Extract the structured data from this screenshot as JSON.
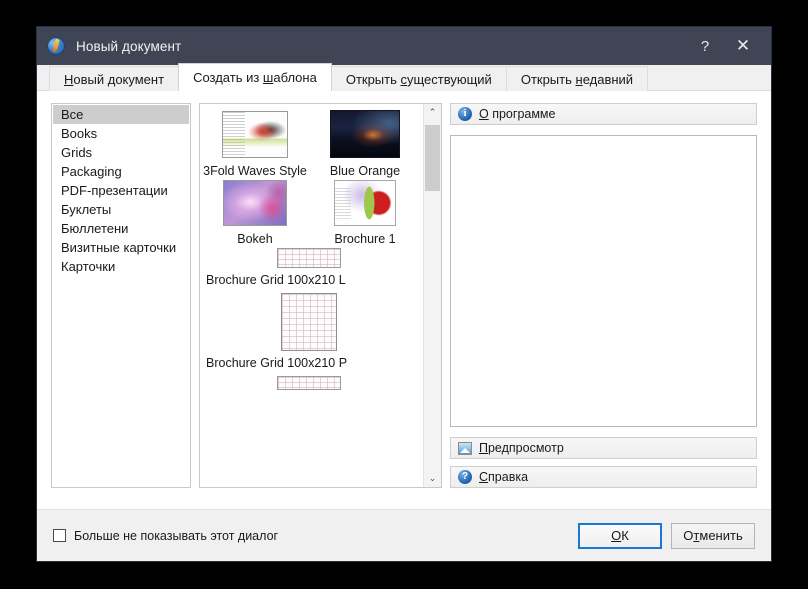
{
  "window": {
    "title": "Новый документ",
    "app_icon": "scribus-icon",
    "help_button": "?",
    "close_button": "✕",
    "titlebar_color": "#3f4554"
  },
  "tabs": [
    {
      "label_pre": "",
      "accel": "Н",
      "label_post": "овый документ",
      "active": false,
      "name": "tab-new-document"
    },
    {
      "label_pre": "Создать из ",
      "accel": "ш",
      "label_post": "аблона",
      "active": true,
      "name": "tab-create-from-template"
    },
    {
      "label_pre": "Открыть ",
      "accel": "с",
      "label_post": "уществующий",
      "active": false,
      "name": "tab-open-existing"
    },
    {
      "label_pre": "Открыть ",
      "accel": "н",
      "label_post": "едавний",
      "active": false,
      "name": "tab-open-recent"
    }
  ],
  "categories": {
    "selected": "Все",
    "items": [
      "Все",
      "Books",
      "Grids",
      "Packaging",
      "PDF-презентации",
      "Буклеты",
      "Бюллетени",
      "Визитные карточки",
      "Карточки"
    ]
  },
  "templates": [
    {
      "label": "3Fold Waves Style",
      "art": "art-3fold"
    },
    {
      "label": "Blue Orange",
      "art": "art-blueorange"
    },
    {
      "label": "Bokeh",
      "art": "art-bokeh"
    },
    {
      "label": "Brochure 1",
      "art": "art-brochure1"
    },
    {
      "label": "Brochure Grid 100x210 L",
      "art": "art-grid-l"
    },
    {
      "label": "Brochure Grid 100x210 P",
      "art": "art-grid-p"
    }
  ],
  "scrollbar": {
    "up_arrow": "⌃",
    "down_arrow": "⌄",
    "thumb_position_pct": 0,
    "thumb_size_pct": 18
  },
  "right_panel": {
    "about": {
      "accel": "О",
      "rest": " программе",
      "icon": "info-icon"
    },
    "preview": {
      "accel": "П",
      "rest": "редпросмотр",
      "icon": "image-icon"
    },
    "help": {
      "accel": "С",
      "rest": "правка",
      "icon": "help-icon"
    },
    "description_text": ""
  },
  "footer": {
    "checkbox_label": "Больше не показывать этот диалог",
    "checkbox_checked": false,
    "ok": {
      "accel": "О",
      "rest": "К"
    },
    "cancel": {
      "pre": "О",
      "accel": "т",
      "post": "менить"
    }
  },
  "colors": {
    "accent": "#1679d6",
    "titlebar": "#3f4554",
    "selection": "#cdcdcd",
    "dialog_bg": "#f0f0f0"
  }
}
